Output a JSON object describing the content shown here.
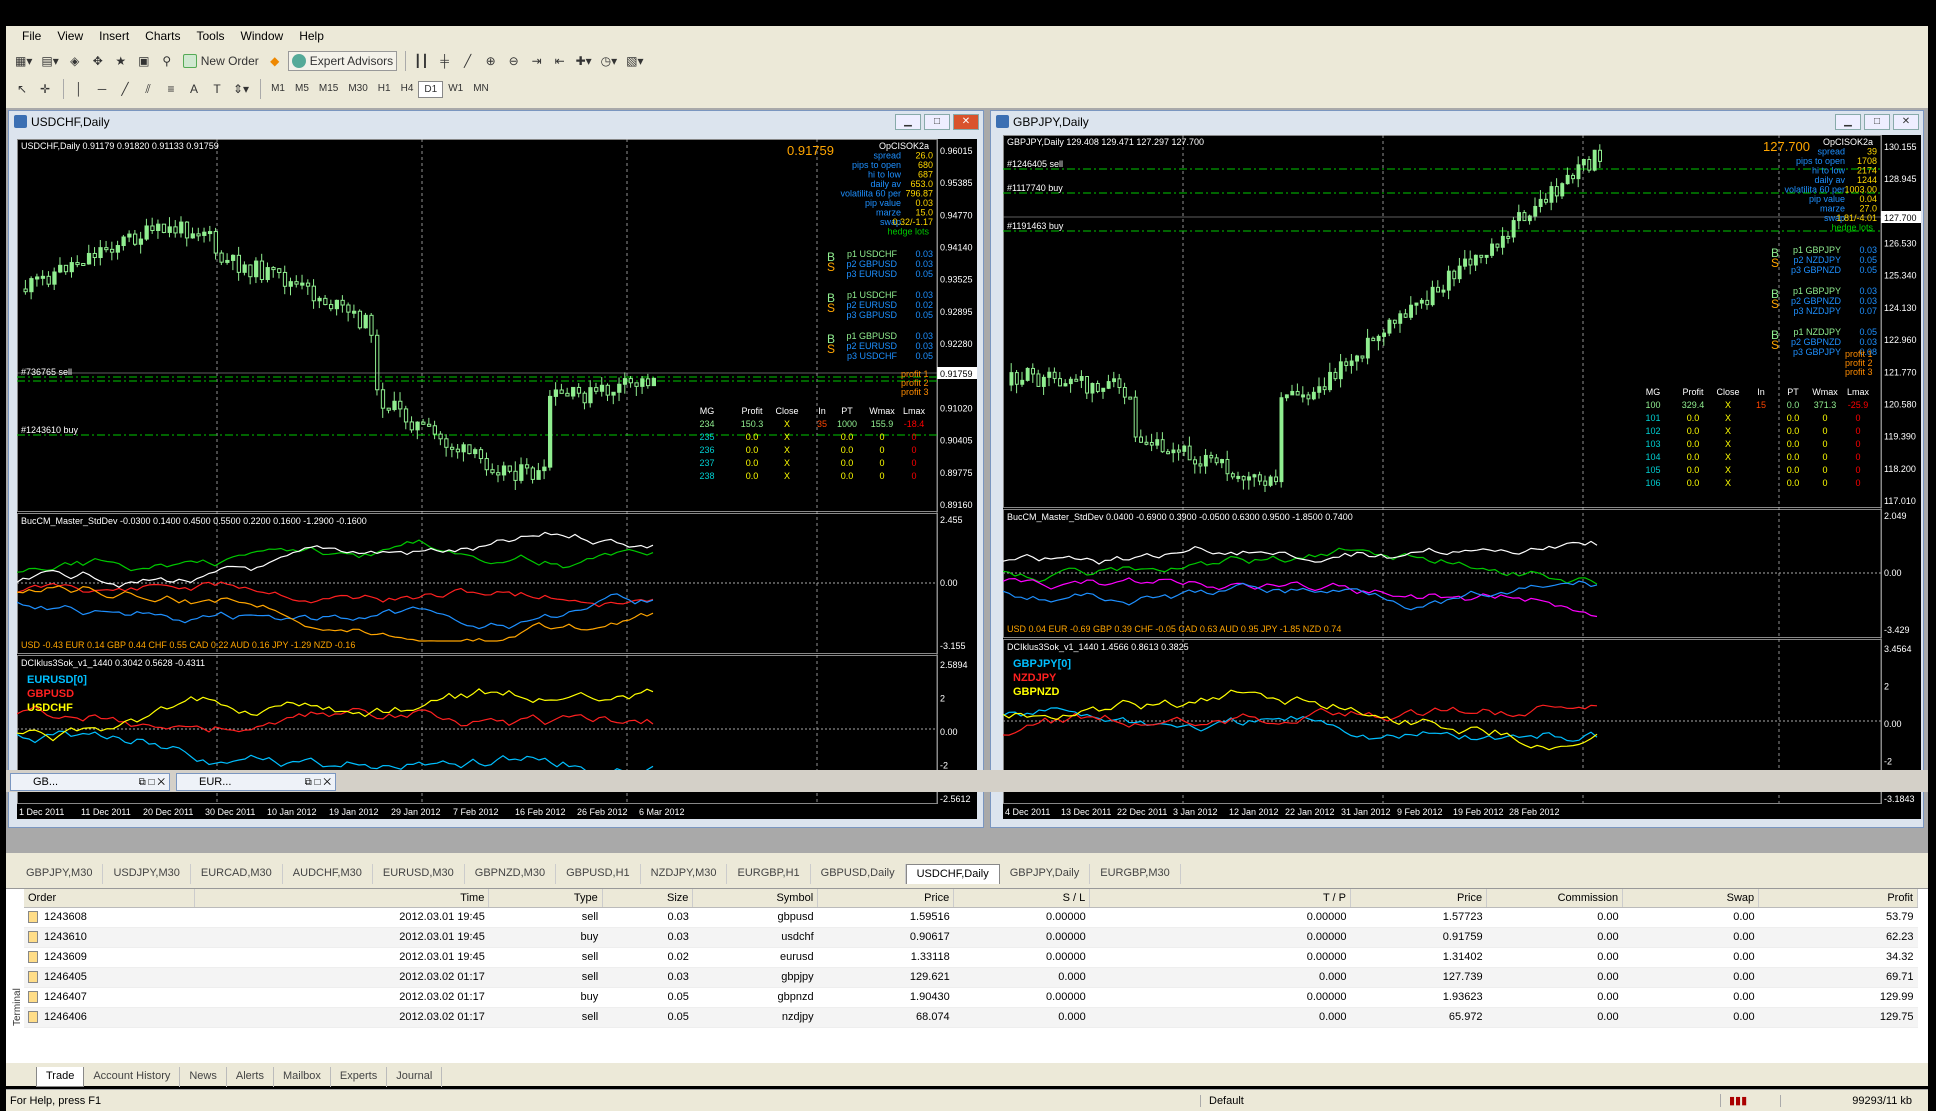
{
  "menu": [
    "File",
    "View",
    "Insert",
    "Charts",
    "Tools",
    "Window",
    "Help"
  ],
  "toolbar": {
    "new_order": "New Order",
    "expert_advisors": "Expert Advisors",
    "timeframes": [
      "M1",
      "M5",
      "M15",
      "M30",
      "H1",
      "H4",
      "D1",
      "W1",
      "MN"
    ],
    "active_tf": "D1"
  },
  "left_window": {
    "title": "USDCHF,Daily",
    "header": "USDCHF,Daily  0.91179 0.91820 0.91133 0.91759",
    "price": "0.91759",
    "sell_label": "#736765 sell",
    "buy_label": "#1243610 buy",
    "info": [
      [
        "OpCISOK2a",
        ""
      ],
      [
        "spread",
        "26.0"
      ],
      [
        "pips to open",
        "680"
      ],
      [
        "hi to low",
        "687"
      ],
      [
        "daily av",
        "653.0"
      ],
      [
        "volatilita 60 per",
        "796.87"
      ],
      [
        "pip value",
        "0.03"
      ],
      [
        "marze",
        "15.0"
      ],
      [
        "swap",
        "0.32/-1.17"
      ],
      [
        "hedge lots",
        ""
      ]
    ],
    "hedge": [
      [
        "B",
        "p1 USDCHF",
        "0.03"
      ],
      [
        "S",
        "p2 GBPUSD",
        "0.03"
      ],
      [
        "",
        "p3 EURUSD",
        "0.05"
      ],
      [
        "B",
        "p1 USDCHF",
        "0.03"
      ],
      [
        "S",
        "p2 EURUSD",
        "0.02"
      ],
      [
        "",
        "p3 GBPUSD",
        "0.05"
      ],
      [
        "B",
        "p1 GBPUSD",
        "0.03"
      ],
      [
        "S",
        "p2 EURUSD",
        "0.03"
      ],
      [
        "",
        "p3 USDCHF",
        "0.05"
      ]
    ],
    "profits": [
      "profit 1",
      "profit 2",
      "profit 3"
    ],
    "mg_header": [
      "MG",
      "Profit",
      "Close",
      "In",
      "PT",
      "Wmax",
      "Lmax"
    ],
    "mg_rows": [
      [
        "234",
        "150.3",
        "X",
        "35",
        "1000",
        "155.9",
        "-18.4"
      ],
      [
        "235",
        "0.0",
        "X",
        "",
        "0.0",
        "0",
        "0"
      ],
      [
        "236",
        "0.0",
        "X",
        "",
        "0.0",
        "0",
        "0"
      ],
      [
        "237",
        "0.0",
        "X",
        "",
        "0.0",
        "0",
        "0"
      ],
      [
        "238",
        "0.0",
        "X",
        "",
        "0.0",
        "0",
        "0"
      ]
    ],
    "yaxis": [
      "0.96015",
      "0.95385",
      "0.94770",
      "0.94140",
      "0.93525",
      "0.92895",
      "0.92280",
      "0.91759",
      "0.91020",
      "0.90405",
      "0.89775",
      "0.89160"
    ],
    "ind1": "BucCM_Master_StdDev -0.0300 0.1400 0.4500 0.5500 0.2200 0.1600 -1.2900 -0.1600",
    "ind1_y": [
      "2.455",
      "0.00",
      "-3.155"
    ],
    "ind1_legend": "USD -0.43  EUR 0.14  GBP 0.44  CHF 0.55  CAD 0.22  AUD 0.16  JPY -1.29  NZD -0.16",
    "ind2": "DCIklus3Sok_v1_1440 0.3042 0.5628 -0.4311",
    "ind2_y": [
      "2.5894",
      "2",
      "0.00",
      "-2",
      "-2.5612"
    ],
    "ind2_legend": [
      "EURUSD[0]",
      "GBPUSD",
      "USDCHF"
    ],
    "xaxis": [
      "1 Dec 2011",
      "11 Dec 2011",
      "20 Dec 2011",
      "30 Dec 2011",
      "10 Jan 2012",
      "19 Jan 2012",
      "29 Jan 2012",
      "7 Feb 2012",
      "16 Feb 2012",
      "26 Feb 2012",
      "6 Mar 2012"
    ]
  },
  "right_window": {
    "title": "GBPJPY,Daily",
    "header": "GBPJPY,Daily  129.408 129.471 127.297 127.700",
    "price": "127.700",
    "labels": [
      "#1246405 sell",
      "#1117740 buy",
      "#1191463 buy"
    ],
    "info": [
      [
        "OpCISOK2a",
        ""
      ],
      [
        "spread",
        "39"
      ],
      [
        "pips to open",
        "1708"
      ],
      [
        "hi to low",
        "2174"
      ],
      [
        "daily av",
        "1244"
      ],
      [
        "volatilita 60 per",
        "1003.00"
      ],
      [
        "pip value",
        "0.04"
      ],
      [
        "marze",
        "27.0"
      ],
      [
        "swap",
        "1.81/-4.01"
      ],
      [
        "hedge lots",
        ""
      ]
    ],
    "hedge": [
      [
        "B",
        "p1 GBPJPY",
        "0.03"
      ],
      [
        "S",
        "p2 NZDJPY",
        "0.05"
      ],
      [
        "",
        "p3 GBPNZD",
        "0.05"
      ],
      [
        "B",
        "p1 GBPJPY",
        "0.03"
      ],
      [
        "S",
        "p2 GBPNZD",
        "0.03"
      ],
      [
        "",
        "p3 NZDJPY",
        "0.07"
      ],
      [
        "B",
        "p1 NZDJPY",
        "0.05"
      ],
      [
        "S",
        "p2 GBPNZD",
        "0.03"
      ],
      [
        "",
        "p3 GBPJPY",
        "0.08"
      ]
    ],
    "profits": [
      "profit 1",
      "profit 2",
      "profit 3"
    ],
    "mg_header": [
      "MG",
      "Profit",
      "Close",
      "In",
      "PT",
      "Wmax",
      "Lmax"
    ],
    "mg_rows": [
      [
        "100",
        "329.4",
        "X",
        "15",
        "0.0",
        "371.3",
        "-25.9"
      ],
      [
        "101",
        "0.0",
        "X",
        "",
        "0.0",
        "0",
        "0"
      ],
      [
        "102",
        "0.0",
        "X",
        "",
        "0.0",
        "0",
        "0"
      ],
      [
        "103",
        "0.0",
        "X",
        "",
        "0.0",
        "0",
        "0"
      ],
      [
        "104",
        "0.0",
        "X",
        "",
        "0.0",
        "0",
        "0"
      ],
      [
        "105",
        "0.0",
        "X",
        "",
        "0.0",
        "0",
        "0"
      ],
      [
        "106",
        "0.0",
        "X",
        "",
        "0.0",
        "0",
        "0"
      ]
    ],
    "yaxis": [
      "130.155",
      "128.945",
      "127.700",
      "126.530",
      "125.340",
      "124.130",
      "122.960",
      "121.770",
      "120.580",
      "119.390",
      "118.200",
      "117.010"
    ],
    "ind1": "BucCM_Master_StdDev 0.0400 -0.6900 0.3900 -0.0500 0.6300 0.9500 -1.8500 0.7400",
    "ind1_y": [
      "2.049",
      "0.00",
      "-3.429"
    ],
    "ind1_legend": "USD 0.04  EUR -0.69  GBP 0.39  CHF -0.05  CAD 0.63  AUD 0.95  JPY -1.85  NZD 0.74",
    "ind2": "DCIklus3Sok_v1_1440 1.4566 0.8613 0.3825",
    "ind2_y": [
      "3.4564",
      "2",
      "0.00",
      "-2",
      "-3.1843"
    ],
    "ind2_legend": [
      "GBPJPY[0]",
      "NZDJPY",
      "GBPNZD"
    ],
    "xaxis": [
      "4 Dec 2011",
      "13 Dec 2011",
      "22 Dec 2011",
      "3 Jan 2012",
      "12 Jan 2012",
      "22 Jan 2012",
      "31 Jan 2012",
      "9 Feb 2012",
      "19 Feb 2012",
      "28 Feb 2012"
    ]
  },
  "min_tabs": [
    "GB...",
    "EUR..."
  ],
  "chart_tabs": [
    "GBPJPY,M30",
    "USDJPY,M30",
    "EURCAD,M30",
    "AUDCHF,M30",
    "EURUSD,M30",
    "GBPNZD,M30",
    "GBPUSD,H1",
    "NZDJPY,M30",
    "EURGBP,H1",
    "GBPUSD,Daily",
    "USDCHF,Daily",
    "GBPJPY,Daily",
    "EURGBP,M30"
  ],
  "active_chart_tab": "USDCHF,Daily",
  "orders": {
    "headers": [
      "Order",
      "Time",
      "Type",
      "Size",
      "Symbol",
      "Price",
      "S / L",
      "T / P",
      "Price",
      "Commission",
      "Swap",
      "Profit"
    ],
    "rows": [
      [
        "1243608",
        "2012.03.01 19:45",
        "sell",
        "0.03",
        "gbpusd",
        "1.59516",
        "0.00000",
        "0.00000",
        "1.57723",
        "0.00",
        "0.00",
        "53.79"
      ],
      [
        "1243610",
        "2012.03.01 19:45",
        "buy",
        "0.03",
        "usdchf",
        "0.90617",
        "0.00000",
        "0.00000",
        "0.91759",
        "0.00",
        "0.00",
        "62.23"
      ],
      [
        "1243609",
        "2012.03.01 19:45",
        "sell",
        "0.02",
        "eurusd",
        "1.33118",
        "0.00000",
        "0.00000",
        "1.31402",
        "0.00",
        "0.00",
        "34.32"
      ],
      [
        "1246405",
        "2012.03.02 01:17",
        "sell",
        "0.03",
        "gbpjpy",
        "129.621",
        "0.000",
        "0.000",
        "127.739",
        "0.00",
        "0.00",
        "69.71"
      ],
      [
        "1246407",
        "2012.03.02 01:17",
        "buy",
        "0.05",
        "gbpnzd",
        "1.90430",
        "0.00000",
        "0.00000",
        "1.93623",
        "0.00",
        "0.00",
        "129.99"
      ],
      [
        "1246406",
        "2012.03.02 01:17",
        "sell",
        "0.05",
        "nzdjpy",
        "68.074",
        "0.000",
        "0.000",
        "65.972",
        "0.00",
        "0.00",
        "129.75"
      ]
    ]
  },
  "terminal_tabs": [
    "Trade",
    "Account History",
    "News",
    "Alerts",
    "Mailbox",
    "Experts",
    "Journal"
  ],
  "terminal_label": "Terminal",
  "status": {
    "help": "For Help, press F1",
    "profile": "Default",
    "traffic": "99293/11 kb"
  },
  "colors": {
    "bull": "#90ee90",
    "bear": "#90ee90",
    "dashgreen": "#00c800",
    "white": "#ffffff"
  }
}
